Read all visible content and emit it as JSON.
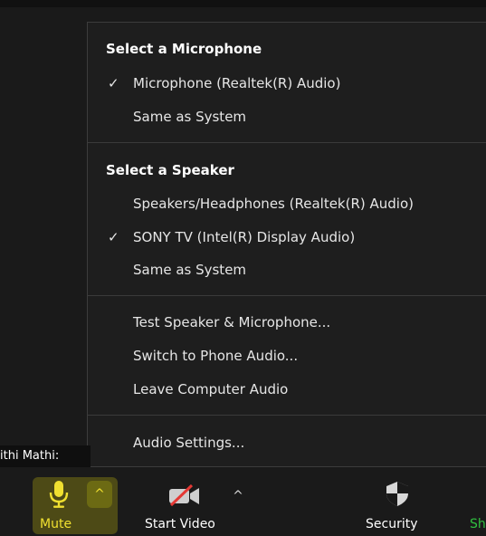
{
  "name_tag": "ithi Mathi:",
  "menu": {
    "mic_header": "Select a Microphone",
    "mic_items": [
      {
        "label": "Microphone (Realtek(R) Audio)",
        "checked": true
      },
      {
        "label": "Same as System",
        "checked": false
      }
    ],
    "speaker_header": "Select a Speaker",
    "speaker_items": [
      {
        "label": "Speakers/Headphones (Realtek(R) Audio)",
        "checked": false
      },
      {
        "label": "SONY TV (Intel(R) Display Audio)",
        "checked": true
      },
      {
        "label": "Same as System",
        "checked": false
      }
    ],
    "action_items": [
      {
        "label": "Test Speaker & Microphone..."
      },
      {
        "label": "Switch to Phone Audio..."
      },
      {
        "label": "Leave Computer Audio"
      }
    ],
    "settings_item": {
      "label": "Audio Settings..."
    },
    "check_glyph": "✓"
  },
  "toolbar": {
    "mute_label": "Mute",
    "video_label": "Start Video",
    "security_label": "Security",
    "share_label": "Sh",
    "caret_glyph": "^"
  },
  "colors": {
    "mute_accent": "#f0e030",
    "share_accent": "#30c040"
  }
}
